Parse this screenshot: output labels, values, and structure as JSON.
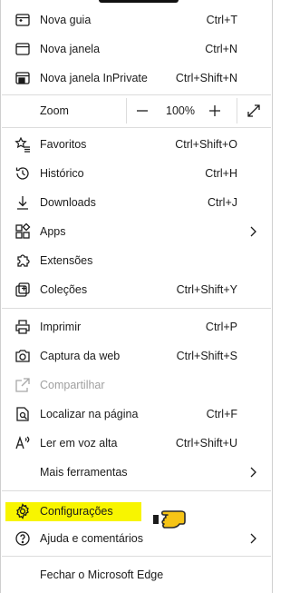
{
  "menu": {
    "items": [
      {
        "label": "Nova guia",
        "shortcut": "Ctrl+T",
        "icon": "new-tab-icon"
      },
      {
        "label": "Nova janela",
        "shortcut": "Ctrl+N",
        "icon": "new-window-icon"
      },
      {
        "label": "Nova janela InPrivate",
        "shortcut": "Ctrl+Shift+N",
        "icon": "inprivate-icon"
      }
    ],
    "zoom": {
      "label": "Zoom",
      "value": "100%",
      "minus": "—",
      "plus": "+"
    },
    "items2": [
      {
        "label": "Favoritos",
        "shortcut": "Ctrl+Shift+O",
        "icon": "favorites-icon"
      },
      {
        "label": "Histórico",
        "shortcut": "Ctrl+H",
        "icon": "history-icon"
      },
      {
        "label": "Downloads",
        "shortcut": "Ctrl+J",
        "icon": "download-icon"
      },
      {
        "label": "Apps",
        "shortcut": "",
        "icon": "apps-icon"
      },
      {
        "label": "Extensões",
        "shortcut": "",
        "icon": "extensions-icon"
      },
      {
        "label": "Coleções",
        "shortcut": "Ctrl+Shift+Y",
        "icon": "collections-icon"
      }
    ],
    "items3": [
      {
        "label": "Imprimir",
        "shortcut": "Ctrl+P",
        "icon": "print-icon"
      },
      {
        "label": "Captura da web",
        "shortcut": "Ctrl+Shift+S",
        "icon": "web-capture-icon"
      },
      {
        "label": "Compartilhar",
        "shortcut": "",
        "icon": "share-icon"
      },
      {
        "label": "Localizar na página",
        "shortcut": "Ctrl+F",
        "icon": "find-icon"
      },
      {
        "label": "Ler em voz alta",
        "shortcut": "Ctrl+Shift+U",
        "icon": "read-aloud-icon"
      },
      {
        "label": "Mais ferramentas",
        "shortcut": "",
        "icon": ""
      }
    ],
    "items4": [
      {
        "label": "Configurações",
        "icon": "settings-icon"
      },
      {
        "label": "Ajuda e comentários",
        "icon": "help-icon"
      }
    ],
    "close": {
      "label": "Fechar o Microsoft Edge"
    }
  },
  "colors": {
    "highlight": "#f8f500",
    "hand": "#f6c416"
  }
}
